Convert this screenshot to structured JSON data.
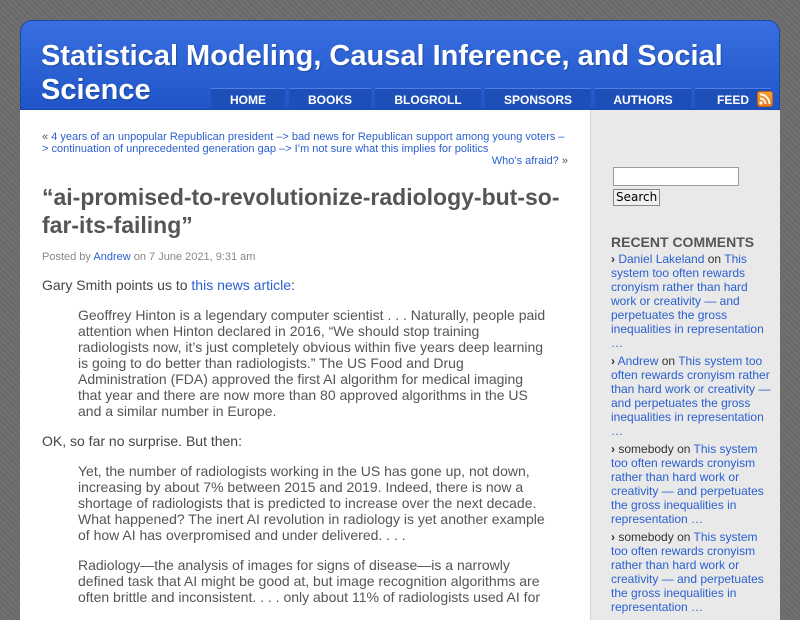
{
  "site": {
    "title": "Statistical Modeling, Causal Inference, and Social Science"
  },
  "nav": {
    "items": [
      "HOME",
      "BOOKS",
      "BLOGROLL",
      "SPONSORS",
      "AUTHORS",
      "FEED"
    ]
  },
  "post_nav": {
    "prev_marker": "«",
    "prev_link": "4 years of an unpopular Republican president –> bad news for Republican support among young voters –> continuation of unprecedented generation gap –> I’m not sure what this implies for politics",
    "next_link": "Who’s afraid?",
    "next_marker": "»"
  },
  "post": {
    "title": "“ai-promised-to-revolutionize-radiology-but-so-far-its-failing”",
    "meta_prefix": "Posted by",
    "author": "Andrew",
    "meta_date": "on 7 June 2021, 9:31 am",
    "intro_text": "Gary Smith points us to",
    "intro_link": "this news article",
    "intro_end": ":",
    "quote1": "Geoffrey Hinton is a legendary computer scientist . . . Naturally, people paid attention when Hinton declared in 2016, “We should stop training radiologists now, it’s just completely obvious within five years deep learning is going to do better than radiologists.” The US Food and Drug Administration (FDA) approved the first AI algorithm for medical imaging that year and there are now more than 80 approved algorithms in the US and a similar number in Europe.",
    "between": "OK, so far no surprise. But then:",
    "quote2a": "Yet, the number of radiologists working in the US has gone up, not down, increasing by about 7% between 2015 and 2019. Indeed, there is now a shortage of radiologists that is predicted to increase over the next decade. What happened? The inert AI revolution in radiology is yet another example of how AI has overpromised and under delivered. . . .",
    "quote2b": "Radiology—the analysis of images for signs of disease—is a narrowly defined task that AI might be good at, but image recognition algorithms are often brittle and inconsistent. . . . only about 11% of radiologists used AI for"
  },
  "sidebar": {
    "search_button": "Search",
    "search_value": "",
    "recent_title": "RECENT COMMENTS",
    "on_word": "on",
    "comments": [
      {
        "author": "Daniel Lakeland",
        "author_link": true,
        "post": "This system too often rewards cronyism rather than hard work or creativity — and perpetuates the gross inequalities in representation …"
      },
      {
        "author": "Andrew",
        "author_link": true,
        "post": "This system too often rewards cronyism rather than hard work or creativity — and perpetuates the gross inequalities in representation …"
      },
      {
        "author": "somebody",
        "author_link": false,
        "post": "This system too often rewards cronyism rather than hard work or creativity — and perpetuates the gross inequalities in representation …"
      },
      {
        "author": "somebody",
        "author_link": false,
        "post": "This system too often rewards cronyism rather than hard work or creativity — and perpetuates the gross inequalities in representation …"
      }
    ]
  },
  "colors": {
    "header_blue": "#2a62d8",
    "link": "#2a5fd0",
    "background": "#6c6c6c",
    "rss_orange": "#f08a24"
  }
}
